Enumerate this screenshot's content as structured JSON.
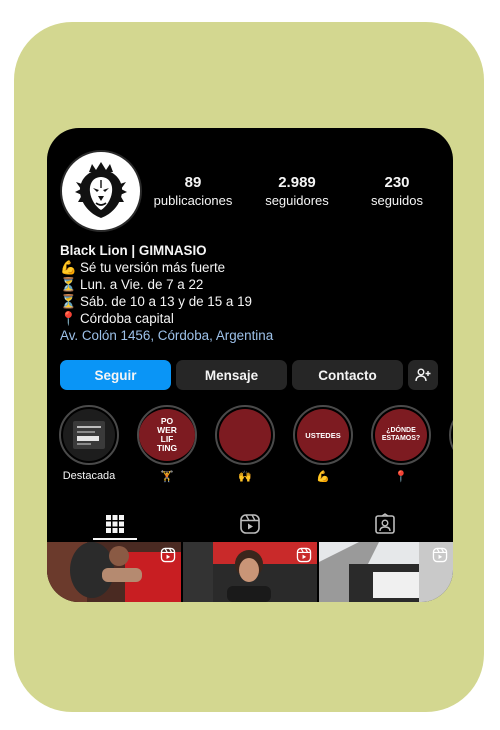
{
  "profile": {
    "name": "Black Lion | GIMNASIO",
    "stats": [
      {
        "value": "89",
        "label": "publicaciones"
      },
      {
        "value": "2.989",
        "label": "seguidores"
      },
      {
        "value": "230",
        "label": "seguidos"
      }
    ],
    "bio": [
      {
        "icon": "💪",
        "icon_name": "flexed-biceps-icon",
        "text": "Sé tu versión más fuerte"
      },
      {
        "icon": "⏳",
        "icon_name": "hourglass-icon",
        "text": "Lun. a Vie. de 7 a 22"
      },
      {
        "icon": "⏳",
        "icon_name": "hourglass-icon",
        "text": "Sáb. de 10 a 13 y de 15 a 19"
      },
      {
        "icon": "📍",
        "icon_name": "location-pin-icon",
        "text": "Córdoba capital"
      }
    ],
    "address": "Av. Colón 1456, Córdoba, Argentina"
  },
  "actions": {
    "follow": "Seguir",
    "message": "Mensaje",
    "contact": "Contacto",
    "add_person_icon": "add-person-icon"
  },
  "highlights": [
    {
      "label": "Destacada",
      "cover_text": ""
    },
    {
      "label": "🏋",
      "cover_text": "PO WER LIF TING"
    },
    {
      "label": "🙌",
      "cover_text": ""
    },
    {
      "label": "💪",
      "cover_text": "USTEDES"
    },
    {
      "label": "📍",
      "cover_text": "¿DÓNDE ESTAMOS?"
    }
  ],
  "tabs": [
    "grid-icon",
    "reels-icon",
    "tagged-icon"
  ],
  "colors": {
    "frame": "#d3d790",
    "screen_bg": "#000000",
    "primary_button": "#0a95f6",
    "secondary_button": "#262626",
    "link": "#9dc1e9",
    "highlight_red": "#7d1b21"
  }
}
